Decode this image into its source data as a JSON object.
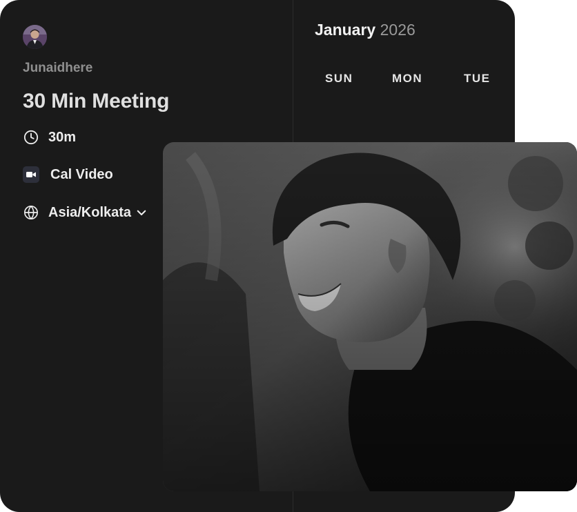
{
  "profile": {
    "username": "Junaidhere",
    "avatar_icon": "user-avatar"
  },
  "event": {
    "title": "30 Min Meeting",
    "duration": "30m",
    "duration_icon": "clock-icon",
    "location": "Cal Video",
    "location_icon": "video-camera-icon",
    "timezone": "Asia/Kolkata",
    "timezone_icon": "globe-icon"
  },
  "calendar": {
    "month": "January",
    "year": "2026",
    "weekdays": [
      "SUN",
      "MON",
      "TUE"
    ]
  },
  "colors": {
    "card_background": "#1a1a1a",
    "page_background": "#ffffff",
    "primary_text": "#e0e0e0",
    "muted_text": "#8f8f8f"
  }
}
